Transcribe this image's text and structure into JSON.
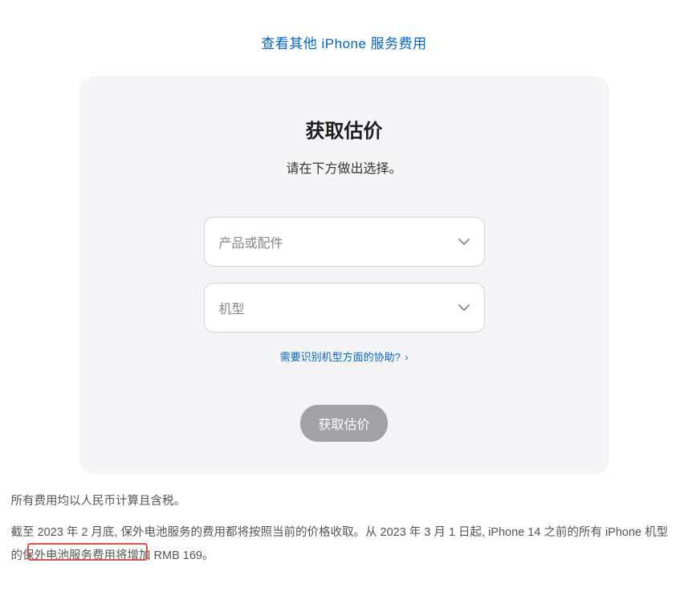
{
  "top_link": {
    "label": "查看其他 iPhone 服务费用"
  },
  "card": {
    "title": "获取估价",
    "subtitle": "请在下方做出选择。",
    "select_product": {
      "placeholder": "产品或配件"
    },
    "select_model": {
      "placeholder": "机型"
    },
    "help_link": {
      "label": "需要识别机型方面的协助?",
      "arrow": "›"
    },
    "submit_label": "获取估价"
  },
  "footnotes": {
    "line1": "所有费用均以人民币计算且含税。",
    "line2": "截至 2023 年 2 月底, 保外电池服务的费用都将按照当前的价格收取。从 2023 年 3 月 1 日起, iPhone 14 之前的所有 iPhone 机型的保外电池服务费用将增加 RMB 169。"
  }
}
